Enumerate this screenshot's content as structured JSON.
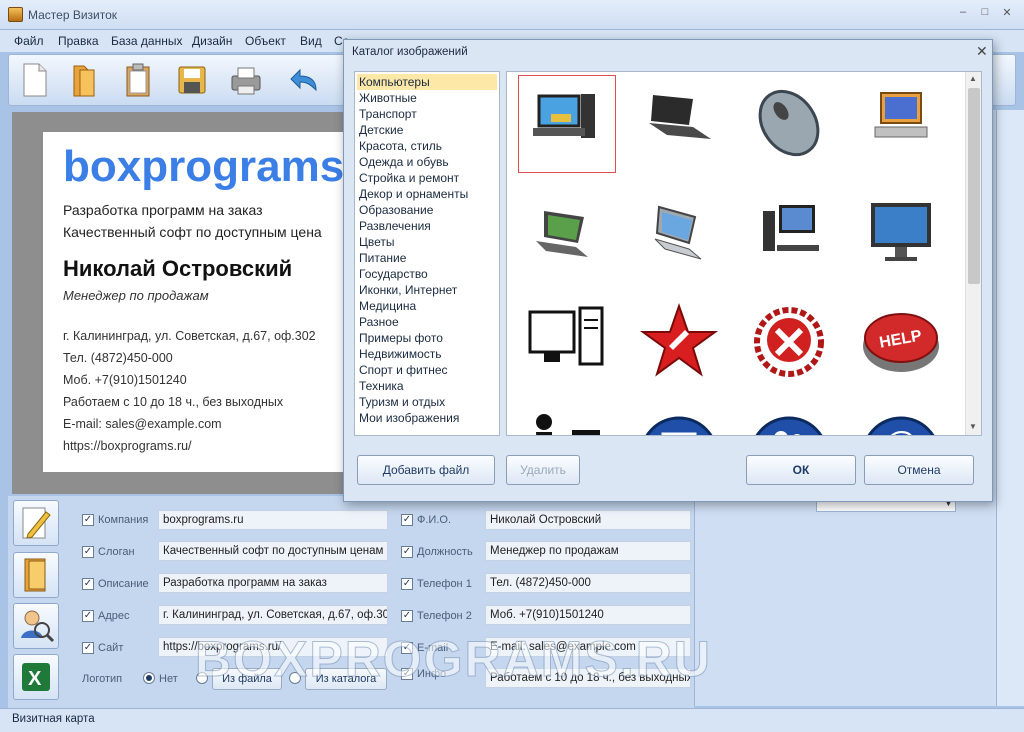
{
  "window": {
    "title": "Мастер Визиток",
    "min": "–",
    "max": "□",
    "close": "✕"
  },
  "menu": [
    "Файл",
    "Правка",
    "База данных",
    "Дизайн",
    "Объект",
    "Вид",
    "Се"
  ],
  "toolbar": {
    "icons": [
      "new-file-icon",
      "open-folder-icon",
      "clipboard-icon",
      "save-icon",
      "print-icon",
      "undo-icon"
    ]
  },
  "card": {
    "company": "boxprograms",
    "line1": "Разработка программ на заказ",
    "line2": "Качественный софт по доступным цена",
    "name": "Николай Островский",
    "position": "Менеджер по продажам",
    "address": "г. Калининград, ул. Советская, д.67, оф.302",
    "phone1": "Тел. (4872)450-000",
    "phone2": "Моб. +7(910)1501240",
    "hours": "Работаем с 10 до 18 ч., без выходных",
    "email": "E-mail: sales@example.com",
    "site": "https://boxprograms.ru/"
  },
  "form": {
    "left": [
      {
        "label": "Компания",
        "value": "boxprograms.ru"
      },
      {
        "label": "Слоган",
        "value": "Качественный софт по доступным ценам"
      },
      {
        "label": "Описание",
        "value": "Разработка программ на заказ"
      },
      {
        "label": "Адрес",
        "value": "г. Калининград, ул. Советская, д.67, оф.30"
      },
      {
        "label": "Сайт",
        "value": "https://boxprograms.ru/"
      }
    ],
    "right": [
      {
        "label": "Ф.И.О.",
        "value": "Николай Островский"
      },
      {
        "label": "Должность",
        "value": "Менеджер по продажам"
      },
      {
        "label": "Телефон 1",
        "value": "Тел. (4872)450-000"
      },
      {
        "label": "Телефон 2",
        "value": "Моб. +7(910)1501240"
      },
      {
        "label": "E-mail",
        "value": "E-mail: sales@example.com"
      },
      {
        "label": "Инфо",
        "value": "Работаем с 10 до 18 ч., без выходных"
      }
    ],
    "logo_label": "Логотип",
    "logo_none": "Нет",
    "logo_from_file": "Из файла",
    "logo_from_catalog": "Из каталога"
  },
  "status": {
    "text": "Визитная карта"
  },
  "watermark": "BOXPROGRAMS.RU",
  "dialog": {
    "title": "Каталог изображений",
    "categories": [
      "Компьютеры",
      "Животные",
      "Транспорт",
      "Детские",
      "Красота, стиль",
      "Одежда и обувь",
      "Стройка и ремонт",
      "Декор и орнаменты",
      "Образование",
      "Развлечения",
      "Цветы",
      "Питание",
      "Государство",
      "Иконки, Интернет",
      "Медицина",
      "Разное",
      "Примеры фото",
      "Недвижимость",
      "Спорт и фитнес",
      "Техника",
      "Туризм и отдых",
      "Мои изображения"
    ],
    "selected_category": 0,
    "images": [
      "desktop-computer-icon",
      "laptop-icon",
      "computer-mouse-icon",
      "computer-user-icon",
      "laptop-open-icon",
      "netbook-icon",
      "pc-tower-monitor-icon",
      "widescreen-monitor-icon",
      "monitor-tower-outline-icon",
      "red-star-icon",
      "hammer-sickle-emblem-icon",
      "help-button-icon",
      "person-at-computer-icon",
      "blue-computer-circle-icon",
      "blue-users-circle-icon",
      "blue-at-sign-circle-icon"
    ],
    "add_file": "Добавить файл",
    "delete": "Удалить",
    "ok": "ОК",
    "cancel": "Отмена"
  }
}
